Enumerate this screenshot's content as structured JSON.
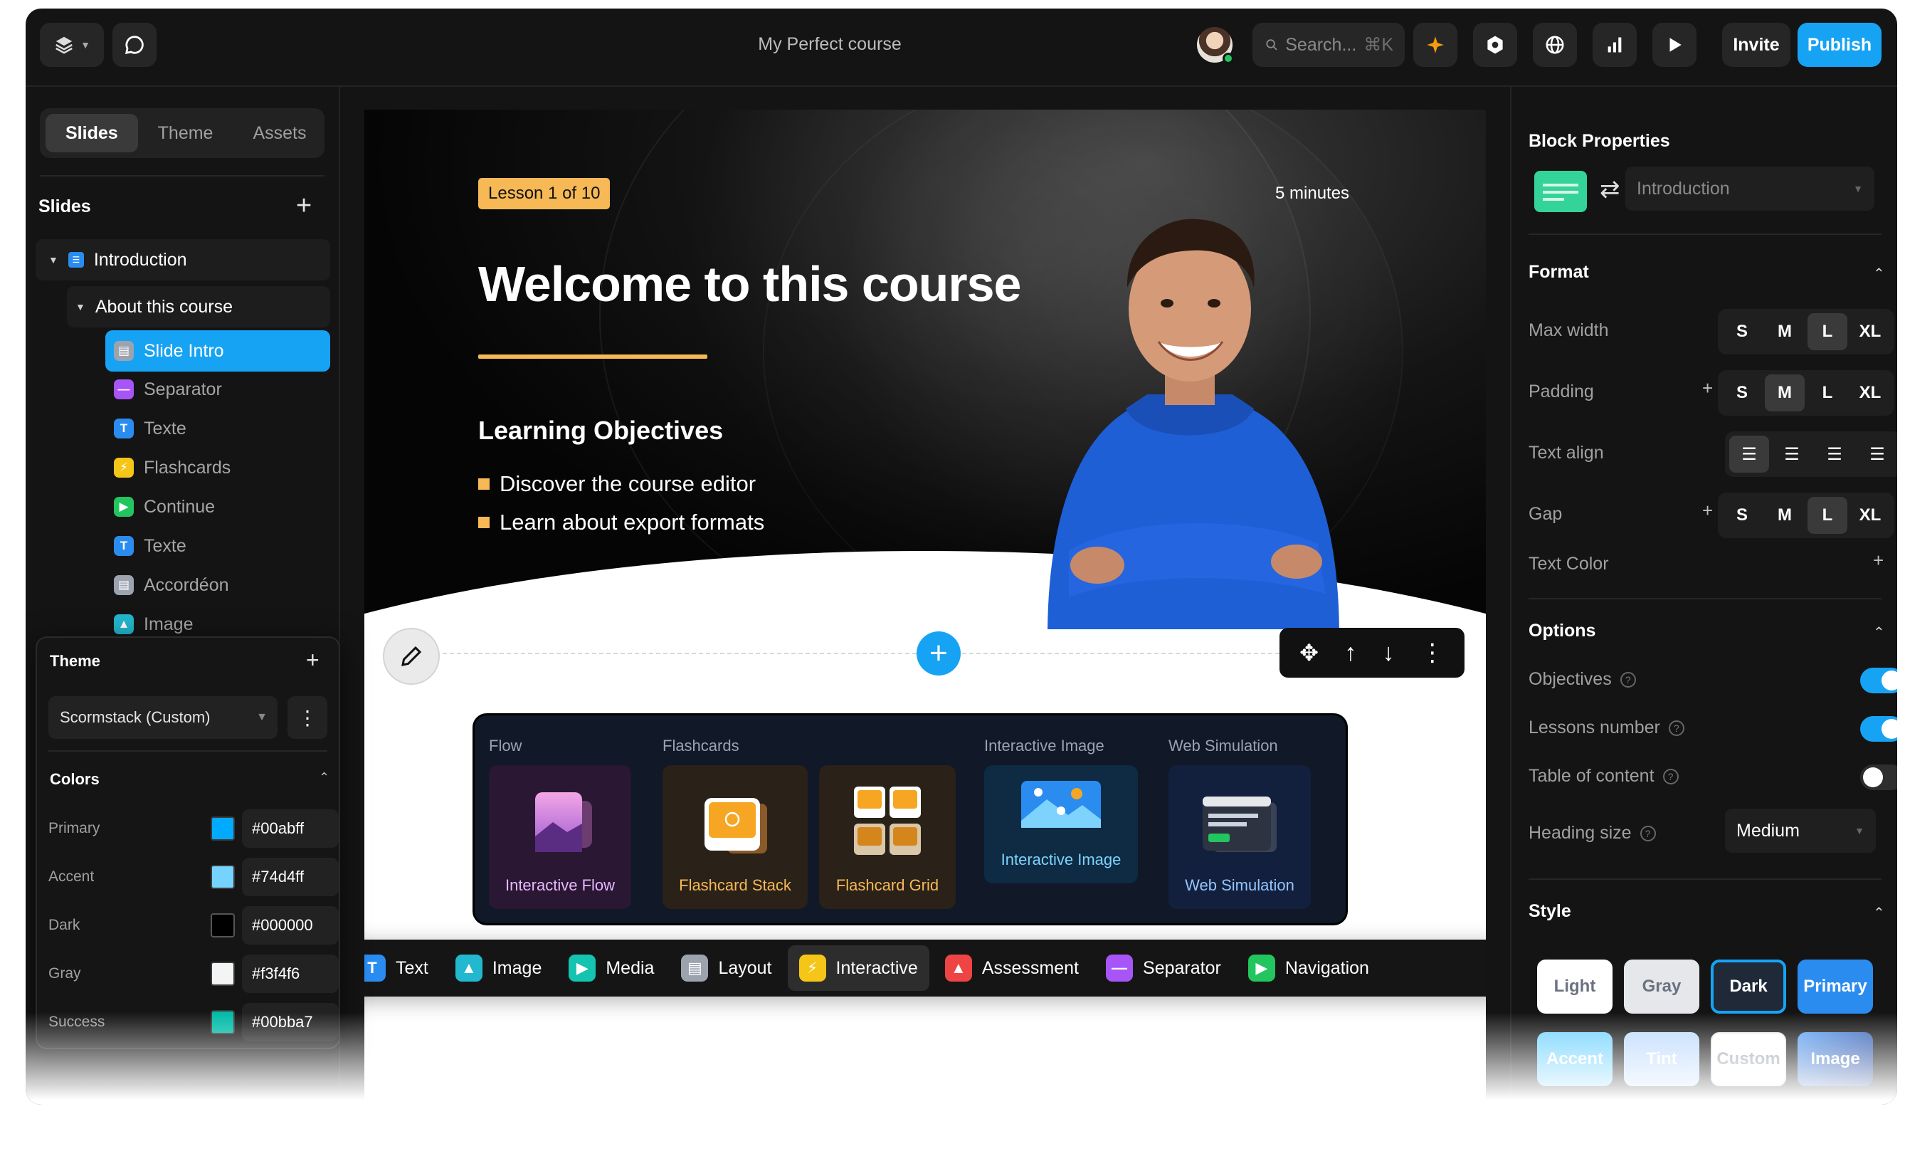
{
  "topbar": {
    "title": "My Perfect course",
    "search_placeholder": "Search...",
    "search_shortcut": "⌘K",
    "invite_label": "Invite",
    "publish_label": "Publish"
  },
  "left": {
    "tabs": [
      "Slides",
      "Theme",
      "Assets"
    ],
    "slides_header": "Slides",
    "tree": {
      "section": "Introduction",
      "subsection": "About this course",
      "items": [
        {
          "label": "Slide Intro",
          "icon": "layout-icon",
          "color": "#9ca3af",
          "glyph": "▤"
        },
        {
          "label": "Separator",
          "icon": "separator-icon",
          "color": "#a855f7",
          "glyph": "—"
        },
        {
          "label": "Texte",
          "icon": "text-icon",
          "color": "#2b8cf0",
          "glyph": "T"
        },
        {
          "label": "Flashcards",
          "icon": "bolt-icon",
          "color": "#f5c518",
          "glyph": "⚡"
        },
        {
          "label": "Continue",
          "icon": "play-icon",
          "color": "#22c55e",
          "glyph": "▶"
        },
        {
          "label": "Texte",
          "icon": "text-icon",
          "color": "#2b8cf0",
          "glyph": "T"
        },
        {
          "label": "Accordéon",
          "icon": "layout-icon",
          "color": "#9ca3af",
          "glyph": "▤"
        },
        {
          "label": "Image",
          "icon": "image-icon",
          "color": "#22b8cf",
          "glyph": "▲"
        }
      ]
    }
  },
  "theme_panel": {
    "title": "Theme",
    "selected_theme": "Scormstack (Custom)",
    "colors_header": "Colors",
    "colors": [
      {
        "name": "Primary",
        "hex": "#00abff"
      },
      {
        "name": "Accent",
        "hex": "#74d4ff"
      },
      {
        "name": "Dark",
        "hex": "#000000"
      },
      {
        "name": "Gray",
        "hex": "#f3f4f6"
      },
      {
        "name": "Success",
        "hex": "#00bba7"
      }
    ]
  },
  "slide": {
    "lesson_badge": "Lesson 1 of 10",
    "duration": "5 minutes",
    "title": "Welcome to this course",
    "objectives_title": "Learning Objectives",
    "objectives": [
      "Discover the course editor",
      "Learn about export formats"
    ]
  },
  "picker": {
    "groups": [
      {
        "label": "Flow"
      },
      {
        "label": "Flashcards"
      },
      {
        "label": "Interactive Image"
      },
      {
        "label": "Web Simulation"
      }
    ],
    "cards": [
      {
        "label": "Interactive Flow",
        "color": "#c084fc"
      },
      {
        "label": "Flashcard Stack",
        "color": "#f7b955"
      },
      {
        "label": "Flashcard Grid",
        "color": "#f7b955"
      },
      {
        "label": "Interactive Image",
        "color": "#38bdf8"
      },
      {
        "label": "Web Simulation",
        "color": "#60a5fa"
      }
    ]
  },
  "component_bar": [
    {
      "label": "Text",
      "icon": "text-icon",
      "color": "#2b8cf0",
      "glyph": "T"
    },
    {
      "label": "Image",
      "icon": "image-icon",
      "color": "#22b8cf",
      "glyph": "▲"
    },
    {
      "label": "Media",
      "icon": "media-icon",
      "color": "#14c3b0",
      "glyph": "▶"
    },
    {
      "label": "Layout",
      "icon": "layout-icon",
      "color": "#9ca3af",
      "glyph": "▤"
    },
    {
      "label": "Interactive",
      "icon": "bolt-icon",
      "color": "#f5c518",
      "glyph": "⚡"
    },
    {
      "label": "Assessment",
      "icon": "flask-icon",
      "color": "#ef4444",
      "glyph": "▲"
    },
    {
      "label": "Separator",
      "icon": "separator-icon",
      "color": "#a855f7",
      "glyph": "—"
    },
    {
      "label": "Navigation",
      "icon": "play-icon",
      "color": "#22c55e",
      "glyph": "▶"
    }
  ],
  "right": {
    "block_properties": "Block Properties",
    "block_type": "Introduction",
    "format_header": "Format",
    "max_width_label": "Max width",
    "padding_label": "Padding",
    "text_align_label": "Text align",
    "gap_label": "Gap",
    "text_color_label": "Text Color",
    "size_options": [
      "S",
      "M",
      "L",
      "XL"
    ],
    "max_width_value": "L",
    "padding_value": "M",
    "gap_value": "L",
    "text_align_value": "left",
    "options_header": "Options",
    "objectives_label": "Objectives",
    "objectives_on": true,
    "lessons_number_label": "Lessons number",
    "lessons_number_on": true,
    "toc_label": "Table of content",
    "toc_on": false,
    "heading_size_label": "Heading size",
    "heading_size_value": "Medium",
    "style_header": "Style",
    "styles": [
      "Light",
      "Gray",
      "Dark",
      "Primary",
      "Accent",
      "Tint",
      "Custom",
      "Image"
    ],
    "style_selected": "Dark"
  },
  "colors": {
    "accent": "#17a3f4",
    "gold": "#f7b955",
    "bg": "#141414"
  }
}
